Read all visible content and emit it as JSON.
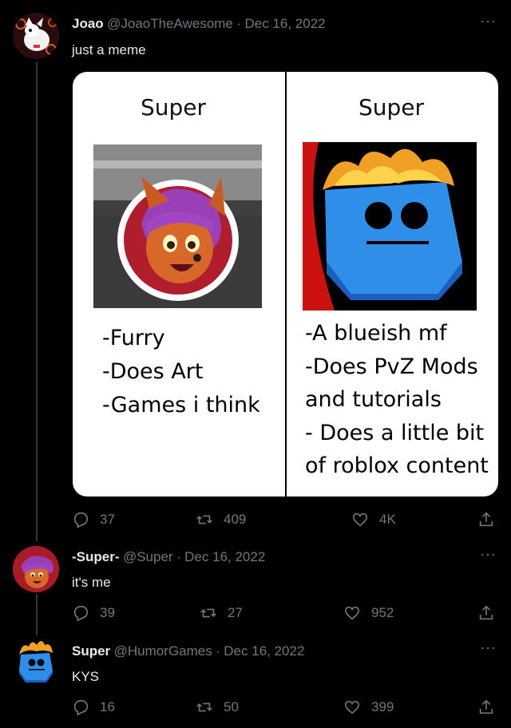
{
  "tweets": [
    {
      "display_name": "Joao",
      "handle": "@JoaoTheAwesome",
      "date": "Dec 16, 2022",
      "text": "just a meme",
      "replies": "37",
      "retweets": "409",
      "likes": "4K"
    },
    {
      "display_name": "-Super-",
      "handle": "@Super",
      "date": "Dec 16, 2022",
      "text": "it's me",
      "replies": "39",
      "retweets": "27",
      "likes": "952"
    },
    {
      "display_name": "Super",
      "handle": "@HumorGames",
      "date": "Dec 16, 2022",
      "text": "KYS",
      "replies": "16",
      "retweets": "50",
      "likes": "399"
    }
  ],
  "separator": "·",
  "more_label": "···",
  "meme": {
    "left": {
      "title": "Super",
      "lines": [
        "-Furry",
        "-Does Art",
        "-Games i think"
      ]
    },
    "right": {
      "title": "Super",
      "lines": [
        "-A blueish mf",
        "-Does PvZ Mods",
        "and tutorials",
        "- Does a little bit",
        "of roblox content"
      ]
    }
  },
  "icons": {
    "reply": "reply-icon",
    "retweet": "retweet-icon",
    "like": "heart-icon",
    "share": "share-icon"
  },
  "colors": {
    "background": "#000000",
    "text": "#e7e9ea",
    "muted": "#71767b",
    "thread_line": "#333639"
  }
}
